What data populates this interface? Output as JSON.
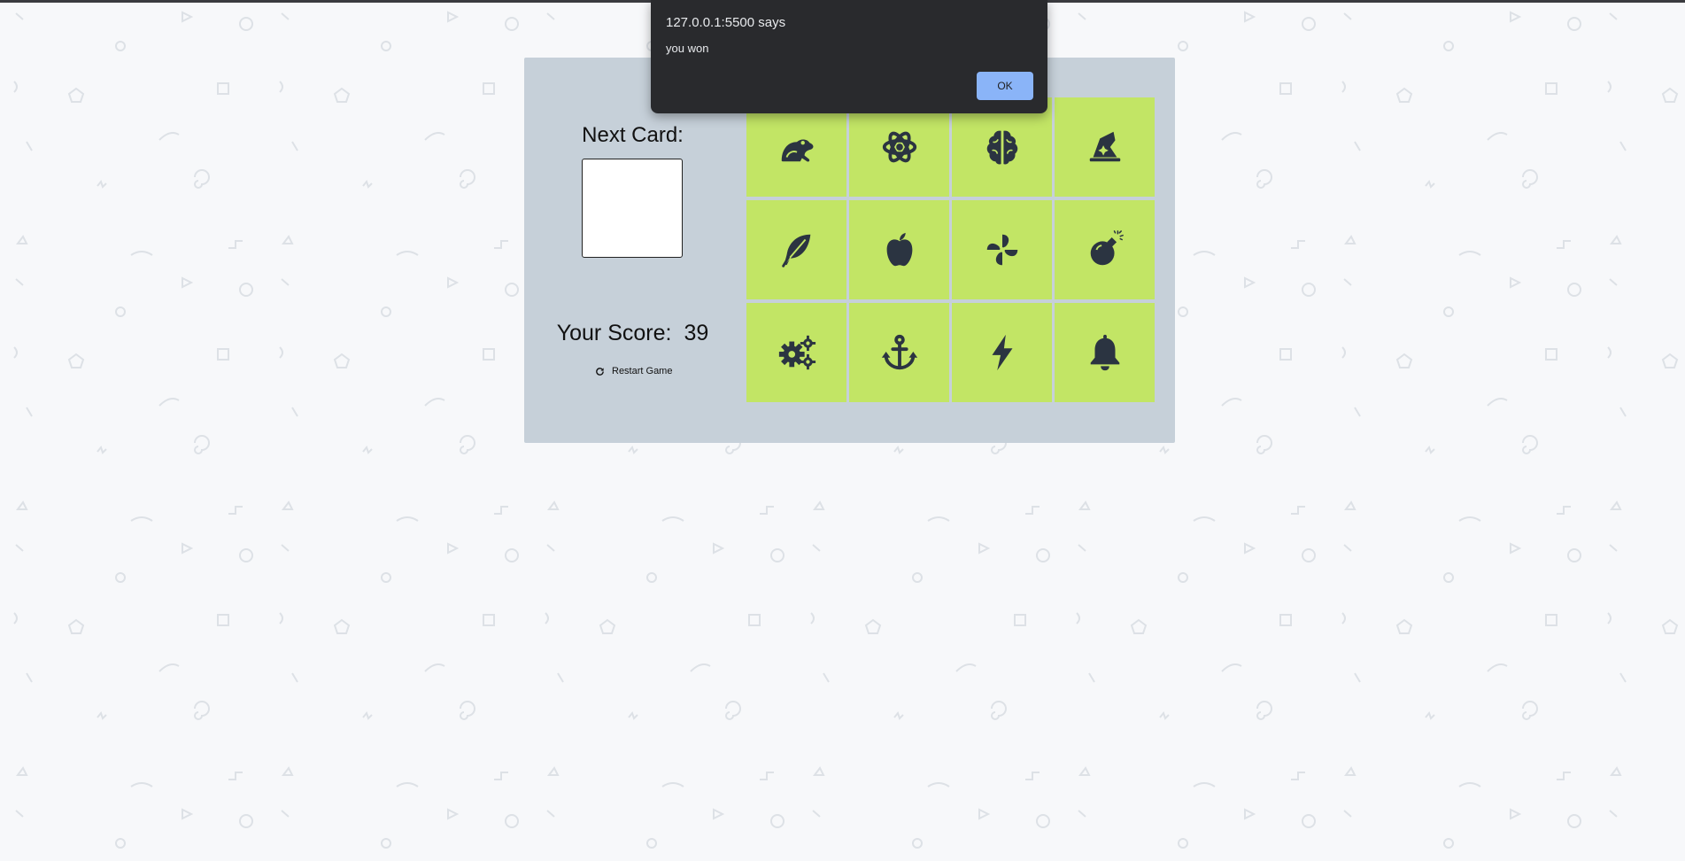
{
  "dialog": {
    "origin": "127.0.0.1:5500 says",
    "message": "you won",
    "ok_label": "OK"
  },
  "side_panel": {
    "next_card_label": "Next Card:",
    "score_label": "Your Score:",
    "score_value": "39",
    "restart_label": "Restart Game"
  },
  "cards": [
    {
      "icon": "frog-icon"
    },
    {
      "icon": "atom-icon"
    },
    {
      "icon": "brain-icon"
    },
    {
      "icon": "wizard-hat-icon"
    },
    {
      "icon": "feather-icon"
    },
    {
      "icon": "apple-icon"
    },
    {
      "icon": "pinwheel-icon"
    },
    {
      "icon": "bomb-icon"
    },
    {
      "icon": "gears-icon"
    },
    {
      "icon": "anchor-icon"
    },
    {
      "icon": "bolt-icon"
    },
    {
      "icon": "bell-icon"
    }
  ],
  "colors": {
    "page_bg": "#f7f8fa",
    "panel_bg": "#c6d0d9",
    "card_bg": "#c2e565",
    "icon": "#2b3441",
    "dialog_bg": "#292a2d",
    "dialog_button": "#8ab4f8"
  }
}
